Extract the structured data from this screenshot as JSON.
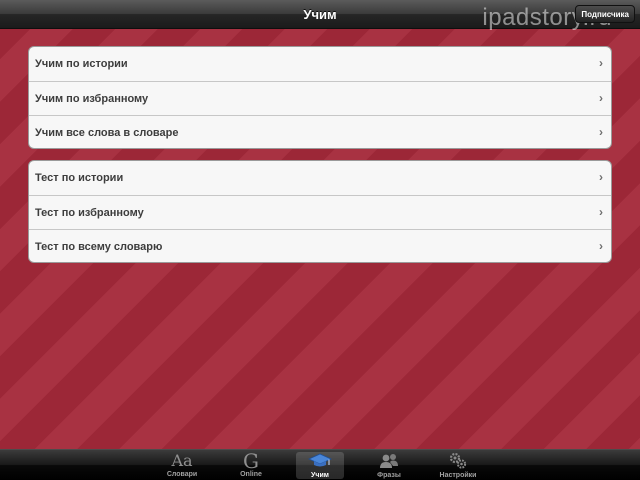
{
  "navbar": {
    "title": "Учим",
    "button_label": "Подписчика"
  },
  "watermark": "ipadstory.ru",
  "groups": [
    {
      "rows": [
        {
          "label": "Учим по истории"
        },
        {
          "label": "Учим по избранному"
        },
        {
          "label": "Учим все слова в словаре"
        }
      ]
    },
    {
      "rows": [
        {
          "label": "Тест по истории"
        },
        {
          "label": "Тест по избранному"
        },
        {
          "label": "Тест по всему словарю"
        }
      ]
    }
  ],
  "chevron_glyph": "›",
  "tabs": [
    {
      "label": "Словари",
      "icon": "dictionary-icon",
      "glyph": "Aa",
      "active": false
    },
    {
      "label": "Online",
      "icon": "google-icon",
      "glyph": "G",
      "active": false
    },
    {
      "label": "Учим",
      "icon": "graduation-cap-icon",
      "active": true
    },
    {
      "label": "Фразы",
      "icon": "people-icon",
      "active": false
    },
    {
      "label": "Настройки",
      "icon": "gears-icon",
      "active": false
    }
  ],
  "colors": {
    "background": "#a4293a",
    "cap_active": "#4a86d8"
  }
}
